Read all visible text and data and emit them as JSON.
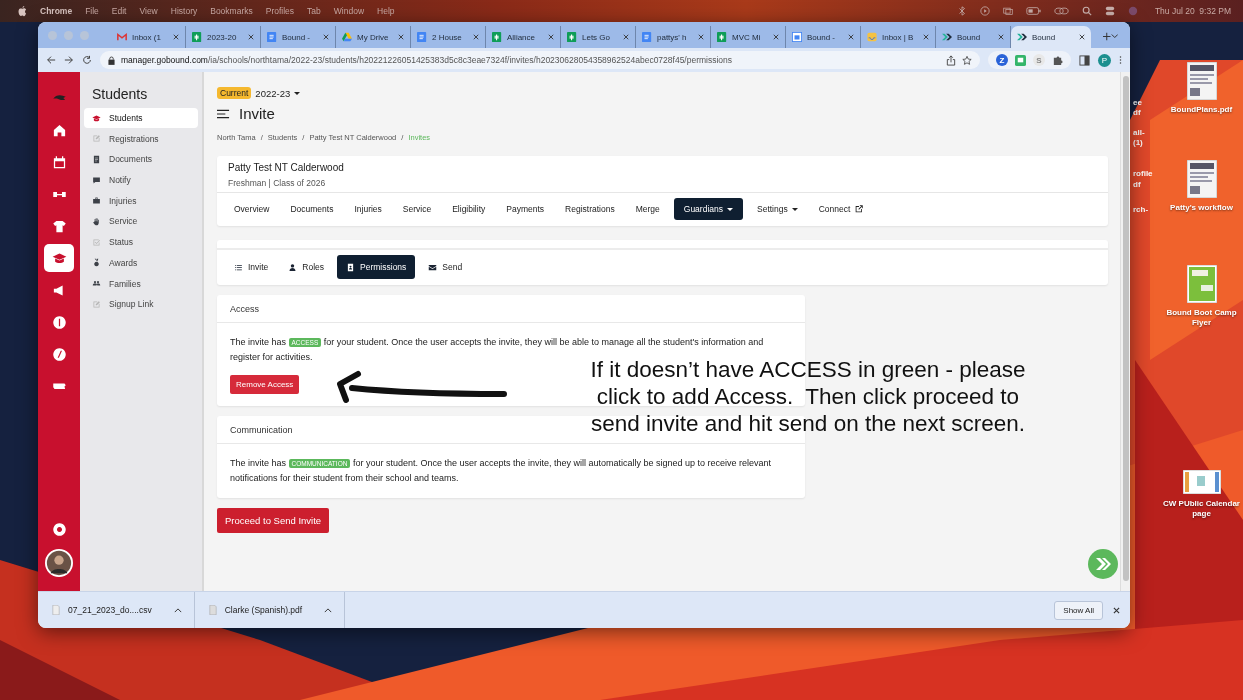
{
  "menu_bar": {
    "app": "Chrome",
    "items": [
      "File",
      "Edit",
      "View",
      "History",
      "Bookmarks",
      "Profiles",
      "Tab",
      "Window",
      "Help"
    ],
    "clock": "Thu Jul 20  9:32 PM"
  },
  "browser": {
    "tabs": [
      {
        "title": "Inbox (1",
        "kind": "mail",
        "selected": false
      },
      {
        "title": "2023-20",
        "kind": "sheet",
        "selected": false
      },
      {
        "title": "Bound -",
        "kind": "doc",
        "selected": false
      },
      {
        "title": "My Drive",
        "kind": "drive",
        "selected": false
      },
      {
        "title": "2 House",
        "kind": "doc",
        "selected": false
      },
      {
        "title": "Alliance",
        "kind": "sheet",
        "selected": false
      },
      {
        "title": "Lets Go",
        "kind": "sheet",
        "selected": false
      },
      {
        "title": "pattys' h",
        "kind": "doc",
        "selected": false
      },
      {
        "title": "MVC Mi",
        "kind": "sheet",
        "selected": false
      },
      {
        "title": "Bound -",
        "kind": "calendar",
        "selected": false
      },
      {
        "title": "Inbox | B",
        "kind": "inbox",
        "selected": false
      },
      {
        "title": "Bound",
        "kind": "bound",
        "selected": false
      },
      {
        "title": "Bound",
        "kind": "bound",
        "selected": true
      }
    ],
    "url_host": "manager.gobound.com",
    "url_path": "/ia/schools/northtama/2022-23/students/h20221226051425383d5c8c3eae7324f/invites/h20230628054358962524abec0728f45/permissions",
    "extensions": [
      {
        "kind": "letter",
        "text": "Z"
      },
      {
        "kind": "tile"
      },
      {
        "kind": "letter",
        "text": "S"
      }
    ],
    "profile_initial": "P"
  },
  "rail": [
    {
      "kind": "logo",
      "selected": false
    },
    {
      "kind": "home",
      "selected": false
    },
    {
      "kind": "calendar",
      "selected": false
    },
    {
      "kind": "bracket",
      "selected": false
    },
    {
      "kind": "jersey",
      "selected": false
    },
    {
      "kind": "cap",
      "selected": true
    },
    {
      "kind": "megaphone",
      "selected": false
    },
    {
      "kind": "dollar",
      "selected": false
    },
    {
      "kind": "compass",
      "selected": false
    },
    {
      "kind": "map",
      "selected": false
    }
  ],
  "sidebar": {
    "title": "Students",
    "items": [
      {
        "label": "Students",
        "kind": "cap",
        "selected": true
      },
      {
        "label": "Registrations",
        "kind": "edit",
        "selected": false
      },
      {
        "label": "Documents",
        "kind": "doc",
        "selected": false
      },
      {
        "label": "Notify",
        "kind": "chat",
        "selected": false
      },
      {
        "label": "Injuries",
        "kind": "briefcase",
        "selected": false
      },
      {
        "label": "Service",
        "kind": "hand",
        "selected": false
      },
      {
        "label": "Status",
        "kind": "check",
        "selected": false
      },
      {
        "label": "Awards",
        "kind": "medal",
        "selected": false
      },
      {
        "label": "Families",
        "kind": "people",
        "selected": false
      },
      {
        "label": "Signup Link",
        "kind": "edit",
        "selected": false
      }
    ]
  },
  "season": {
    "badge": "Current",
    "year": "2022-23"
  },
  "page_title": "Invite",
  "breadcrumbs": [
    {
      "label": "North Tama",
      "current": false
    },
    {
      "separator": "/",
      "label": "Students",
      "current": false
    },
    {
      "separator": "/",
      "label": "Patty Test NT Calderwood",
      "current": false
    },
    {
      "separator": "/",
      "label": "Invites",
      "current": true
    }
  ],
  "student": {
    "name": "Patty Test NT Calderwood",
    "subtitle": "Freshman | Class of 2026"
  },
  "nav_tabs": [
    {
      "label": "Overview",
      "kind": "plain",
      "selected": false
    },
    {
      "label": "Documents",
      "kind": "plain",
      "selected": false
    },
    {
      "label": "Injuries",
      "kind": "plain",
      "selected": false
    },
    {
      "label": "Service",
      "kind": "plain",
      "selected": false
    },
    {
      "label": "Eligibility",
      "kind": "plain",
      "selected": false
    },
    {
      "label": "Payments",
      "kind": "plain",
      "selected": false
    },
    {
      "label": "Registrations",
      "kind": "plain",
      "selected": false
    },
    {
      "label": "Merge",
      "kind": "plain",
      "selected": false
    },
    {
      "label": "Guardians",
      "kind": "dropdown",
      "selected": true
    },
    {
      "label": "Settings",
      "kind": "dropdown",
      "selected": false
    },
    {
      "label": "Connect",
      "kind": "external",
      "selected": false
    }
  ],
  "sub_tabs": [
    {
      "label": "Invite",
      "kind": "list",
      "selected": false
    },
    {
      "label": "Roles",
      "kind": "person",
      "selected": false
    },
    {
      "label": "Permissions",
      "kind": "idcard",
      "selected": true
    },
    {
      "label": "Send",
      "kind": "envelope",
      "selected": false
    }
  ],
  "sections": [
    {
      "title": "Access",
      "text_before": "The invite has",
      "badge": "ACCESS",
      "text_after": "for your student. Once the user accepts the invite, they will be able to manage all the student's information and register for activities.",
      "button": "Remove Access"
    },
    {
      "title": "Communication",
      "text_before": "The invite has",
      "badge": "COMMUNICATION",
      "text_after": "for your student. Once the user accepts the invite, they will automatically be signed up to receive relevant notifications for their student from their school and teams."
    }
  ],
  "proceed_button": "Proceed to Send Invite",
  "annotation": "If it doesn’t have ACCESS in green - please click to add Access.  Then click proceed to send invite and hit send on the next screen.",
  "downloads": [
    {
      "name": "07_21_2023_do....csv",
      "kind": "sheet"
    },
    {
      "name": "Clarke (Spanish).pdf",
      "kind": "doc"
    }
  ],
  "show_all": "Show All",
  "desktop_icons": [
    {
      "label": "BoundPlans.pdf",
      "kind": "doc"
    },
    {
      "label": "Patty's workflow",
      "kind": "doc"
    },
    {
      "label": "Bound Boot Camp Flyer",
      "kind": "flyer"
    },
    {
      "label": "CW PUblic Calendar page",
      "kind": "sheet"
    }
  ],
  "hidden_desktop_labels": [
    "ee",
    "df",
    "all-",
    "(1)",
    "rofile",
    "df",
    "rch-"
  ]
}
